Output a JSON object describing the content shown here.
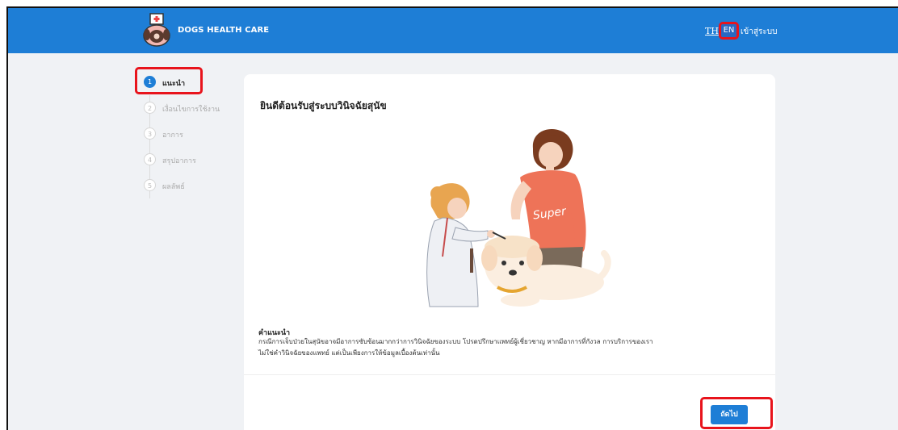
{
  "header": {
    "brand": "DOGS HEALTH CARE",
    "lang_th": "TH",
    "lang_en": "EN",
    "login": "เข้าสู่ระบบ"
  },
  "steps": [
    {
      "num": "1",
      "label": "แนะนำ",
      "active": true
    },
    {
      "num": "2",
      "label": "เงื่อนไขการใช้งาน",
      "active": false
    },
    {
      "num": "3",
      "label": "อาการ",
      "active": false
    },
    {
      "num": "4",
      "label": "สรุปอาการ",
      "active": false
    },
    {
      "num": "5",
      "label": "ผลลัพธ์",
      "active": false
    }
  ],
  "card": {
    "title": "ยินดีต้อนรับสู่ระบบวินิจฉัยสุนัข",
    "shirt_text": "Super",
    "advice_title": "คำแนะนำ",
    "advice_line1": "กรณีการเจ็บป่วยในสุนัขอาจมีอาการซับซ้อนมากกว่าการวินิจฉัยของระบบ โปรดปรึกษาแพทย์ผู้เชี่ยวชาญ หากมีอาการที่กังวล การบริการของเรา",
    "advice_line2": "ไม่ใช่คำวินิจฉัยของแพทย์ แต่เป็นเพียงการให้ข้อมูลเบื้องต้นเท่านั้น",
    "next_label": "ถัดไป"
  },
  "colors": {
    "primary": "#1e7ed6",
    "highlight": "#e8141c",
    "background": "#f0f2f5"
  }
}
